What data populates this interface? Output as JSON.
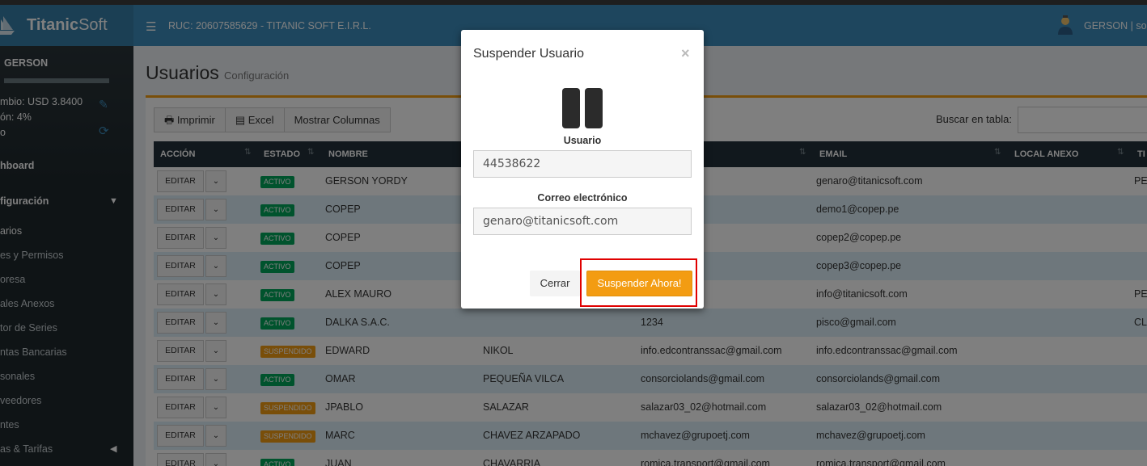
{
  "header": {
    "brand_prefix": "Titanic",
    "brand_suffix": "Soft",
    "menu_icon": "hamburger-icon",
    "ruc_text": "RUC: 20607585629 - TITANIC SOFT E.I.R.L.",
    "user_text": "GERSON | sop"
  },
  "sidebar": {
    "user_name": "GERSON",
    "rate_line1": "mbio: USD 3.8400",
    "rate_line2": "ón: 4%",
    "rate_line3": "o",
    "items": [
      {
        "label": "hboard"
      },
      {
        "label": "figuración"
      },
      {
        "label": "arios"
      },
      {
        "label": "es y Permisos"
      },
      {
        "label": "oresa"
      },
      {
        "label": "ales Anexos"
      },
      {
        "label": "tor de Series"
      },
      {
        "label": "ntas Bancarias"
      },
      {
        "label": "sonales"
      },
      {
        "label": "veedores"
      },
      {
        "label": "ntes"
      },
      {
        "label": "as & Tarifas"
      }
    ]
  },
  "page": {
    "title": "Usuarios",
    "subtitle": "Configuración"
  },
  "toolbar": {
    "print_label": "Imprimir",
    "excel_label": "Excel",
    "columns_label": "Mostrar Columnas",
    "search_label": "Buscar en tabla:",
    "search_value": ""
  },
  "table": {
    "headers": [
      "ACCIÓN",
      "ESTADO",
      "NOMBRE",
      "EMAIL",
      "LOCAL ANEXO",
      "TI"
    ],
    "edit_label": "EDITAR",
    "rows": [
      {
        "estado": "ACTIVO",
        "nombre": "GERSON YORDY",
        "apellido": "",
        "usuario": "",
        "email": "genaro@titanicsoft.com",
        "extra": "PE"
      },
      {
        "estado": "ACTIVO",
        "nombre": "COPEP",
        "apellido": "",
        "usuario": "",
        "email": "demo1@copep.pe",
        "extra": ""
      },
      {
        "estado": "ACTIVO",
        "nombre": "COPEP",
        "apellido": "",
        "usuario": "",
        "email": "copep2@copep.pe",
        "extra": ""
      },
      {
        "estado": "ACTIVO",
        "nombre": "COPEP",
        "apellido": "",
        "usuario": "",
        "email": "copep3@copep.pe",
        "extra": ""
      },
      {
        "estado": "ACTIVO",
        "nombre": "ALEX MAURO",
        "apellido": "",
        "usuario": "",
        "email": "info@titanicsoft.com",
        "extra": "PE"
      },
      {
        "estado": "ACTIVO",
        "nombre": "DALKA S.A.C.",
        "apellido": "",
        "usuario": "1234",
        "email": "pisco@gmail.com",
        "extra": "CL"
      },
      {
        "estado": "SUSPENDIDO",
        "nombre": "EDWARD",
        "apellido": "NIKOL",
        "usuario": "info.edcontranssac@gmail.com",
        "email": "info.edcontranssac@gmail.com",
        "extra": ""
      },
      {
        "estado": "ACTIVO",
        "nombre": "OMAR",
        "apellido": "PEQUEÑA VILCA",
        "usuario": "consorciolands@gmail.com",
        "email": "consorciolands@gmail.com",
        "extra": ""
      },
      {
        "estado": "SUSPENDIDO",
        "nombre": "JPABLO",
        "apellido": "SALAZAR",
        "usuario": "salazar03_02@hotmail.com",
        "email": "salazar03_02@hotmail.com",
        "extra": ""
      },
      {
        "estado": "SUSPENDIDO",
        "nombre": "MARC",
        "apellido": "CHAVEZ ARZAPADO",
        "usuario": "mchavez@grupoetj.com",
        "email": "mchavez@grupoetj.com",
        "extra": ""
      },
      {
        "estado": "ACTIVO",
        "nombre": "JUAN",
        "apellido": "CHAVARRIA",
        "usuario": "romica.transport@gmail.com",
        "email": "romica.transport@gmail.com",
        "extra": ""
      }
    ]
  },
  "modal": {
    "title": "Suspender Usuario",
    "close_symbol": "×",
    "icon": "pause-icon",
    "usuario_label": "Usuario",
    "usuario_value": "44538622",
    "email_label": "Correo electrónico",
    "email_value": "genaro@titanicsoft.com",
    "cancel_label": "Cerrar",
    "confirm_label": "Suspender Ahora!"
  },
  "colors": {
    "header_bg": "#3c8dbc",
    "sidebar_bg": "#1e282c",
    "accent_orange": "#f39c12",
    "status_active": "#00a65a",
    "highlight_red": "#e00000"
  }
}
